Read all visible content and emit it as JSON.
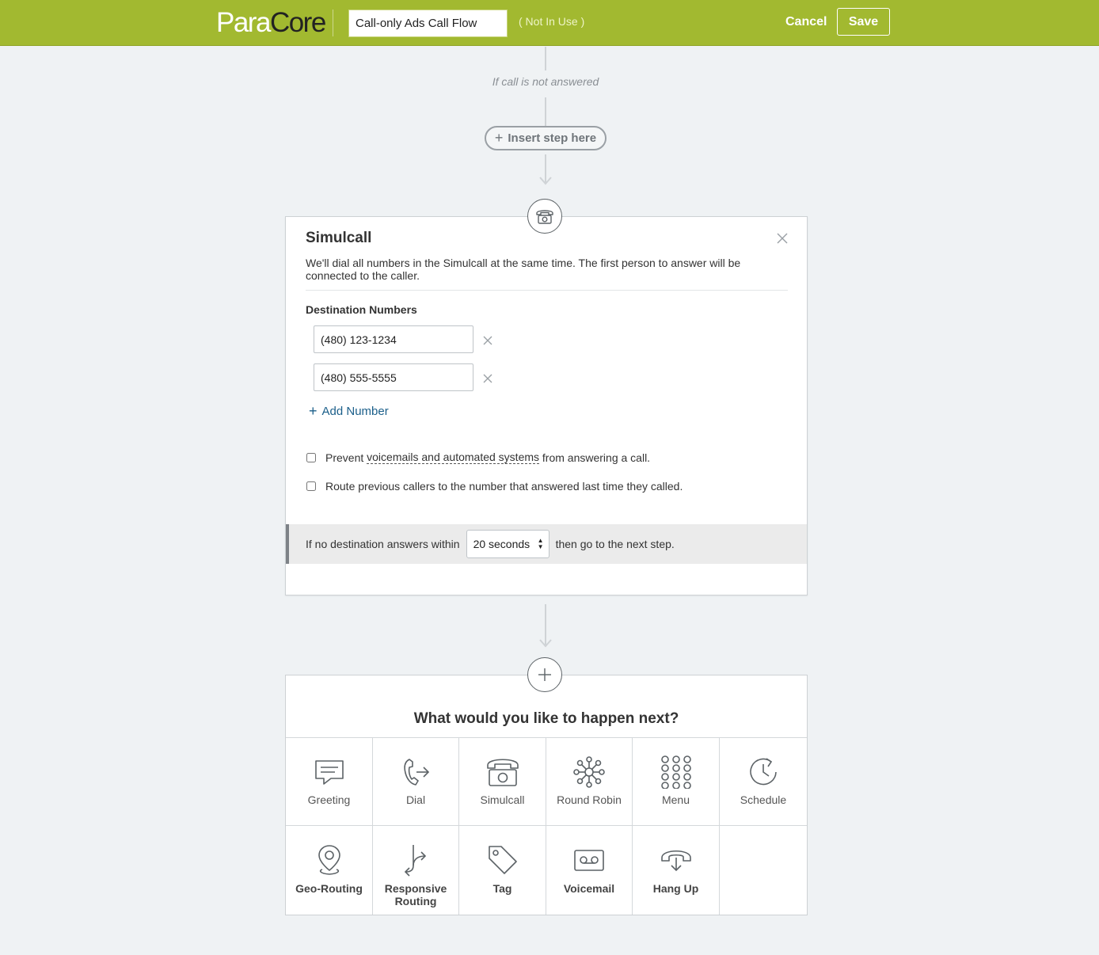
{
  "header": {
    "logo_part1": "Para",
    "logo_part2": "Core",
    "flow_name": "Call-only Ads Call Flow",
    "status": "( Not In Use )",
    "cancel_label": "Cancel",
    "save_label": "Save",
    "brand_color": "#a2b930"
  },
  "flow": {
    "branch_label": "If call is not answered",
    "insert_label": "Insert step here"
  },
  "simulcall": {
    "icon": "phone-icon",
    "title": "Simulcall",
    "description": "We'll dial all numbers in the Simulcall at the same time. The first person to answer will be connected to the caller.",
    "destinations_label": "Destination Numbers",
    "numbers": [
      "(480) 123-1234",
      "(480) 555-5555"
    ],
    "add_number_label": "Add Number",
    "option1_prefix": "Prevent ",
    "option1_link": "voicemails and automated systems",
    "option1_suffix": " from answering a call.",
    "option2": "Route previous callers to the number that answered last time they called.",
    "timeout_prefix": "If no destination answers within",
    "timeout_value": "20 seconds",
    "timeout_suffix": "then go to the next step."
  },
  "next_step": {
    "title": "What would you like to happen next?",
    "options": [
      {
        "label": "Greeting",
        "icon": "chat-bubble-icon"
      },
      {
        "label": "Dial",
        "icon": "dial-icon"
      },
      {
        "label": "Simulcall",
        "icon": "phone-icon"
      },
      {
        "label": "Round Robin",
        "icon": "hub-icon"
      },
      {
        "label": "Menu",
        "icon": "keypad-icon"
      },
      {
        "label": "Schedule",
        "icon": "clock-icon"
      },
      {
        "label": "Geo-Routing",
        "icon": "map-pin-icon"
      },
      {
        "label": "Responsive Routing",
        "icon": "routing-icon"
      },
      {
        "label": "Tag",
        "icon": "tag-icon"
      },
      {
        "label": "Voicemail",
        "icon": "voicemail-icon"
      },
      {
        "label": "Hang Up",
        "icon": "hang-up-icon"
      }
    ]
  }
}
